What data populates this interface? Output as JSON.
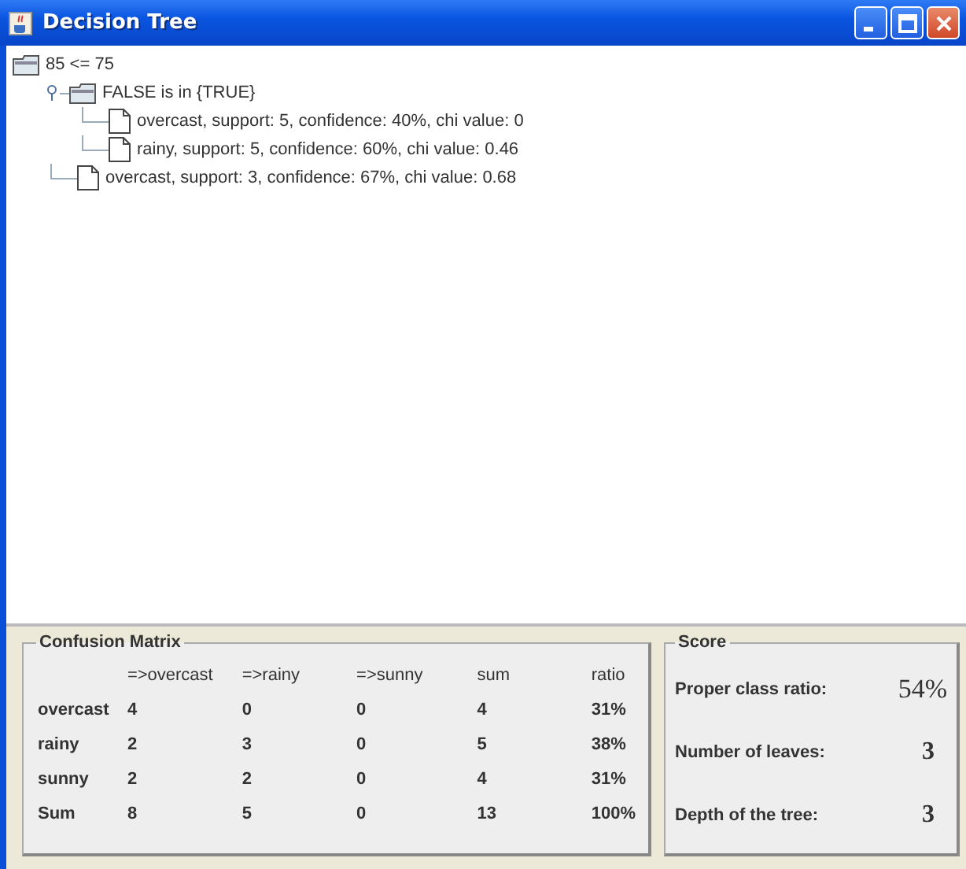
{
  "window": {
    "title": "Decision Tree"
  },
  "tree": {
    "label": "85 <= 75",
    "expanded": true,
    "children": [
      {
        "label": "FALSE is in {TRUE}",
        "expanded": true,
        "children": [
          {
            "label": "overcast, support: 5, confidence: 40%, chi value: 0"
          },
          {
            "label": "rainy, support: 5, confidence: 60%, chi value: 0.46"
          }
        ]
      },
      {
        "label": "overcast, support: 3, confidence: 67%, chi value: 0.68"
      }
    ]
  },
  "confusion_matrix": {
    "title": "Confusion Matrix",
    "columns": [
      "=>overcast",
      "=>rainy",
      "=>sunny",
      "sum",
      "ratio"
    ],
    "rows": [
      {
        "label": "overcast",
        "cells": [
          "4",
          "0",
          "0",
          "4",
          "31%"
        ]
      },
      {
        "label": "rainy",
        "cells": [
          "2",
          "3",
          "0",
          "5",
          "38%"
        ]
      },
      {
        "label": "sunny",
        "cells": [
          "2",
          "2",
          "0",
          "4",
          "31%"
        ]
      },
      {
        "label": "Sum",
        "cells": [
          "8",
          "5",
          "0",
          "13",
          "100%"
        ]
      }
    ]
  },
  "score": {
    "title": "Score",
    "items": [
      {
        "label": "Proper class ratio:",
        "value": "54%",
        "kind": "large"
      },
      {
        "label": "Number of leaves:",
        "value": "3",
        "kind": "normal"
      },
      {
        "label": "Depth of the tree:",
        "value": "3",
        "kind": "normal"
      }
    ]
  }
}
